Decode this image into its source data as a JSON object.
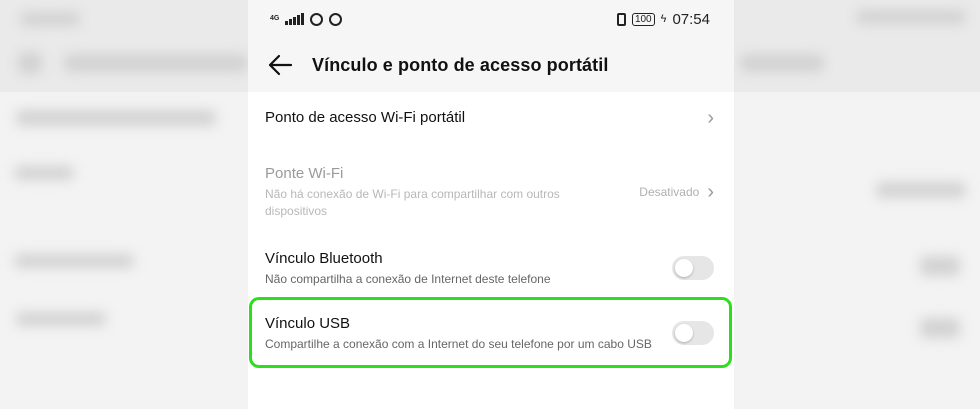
{
  "statusbar": {
    "network": "4G",
    "battery": "100",
    "time": "07:54"
  },
  "header": {
    "title": "Vínculo e ponto de acesso portátil"
  },
  "items": [
    {
      "title": "Ponto de acesso Wi-Fi portátil"
    },
    {
      "title": "Ponte Wi-Fi",
      "subtitle": "Não há conexão de Wi-Fi para compartilhar com outros dispositivos",
      "state": "Desativado"
    },
    {
      "title": "Vínculo Bluetooth",
      "subtitle": "Não compartilha a conexão de Internet deste telefone",
      "toggle_on": false
    },
    {
      "title": "Vínculo USB",
      "subtitle": "Compartilhe a conexão com a Internet do seu telefone por um cabo USB",
      "toggle_on": false
    }
  ],
  "highlight_color": "#2bdf1c"
}
